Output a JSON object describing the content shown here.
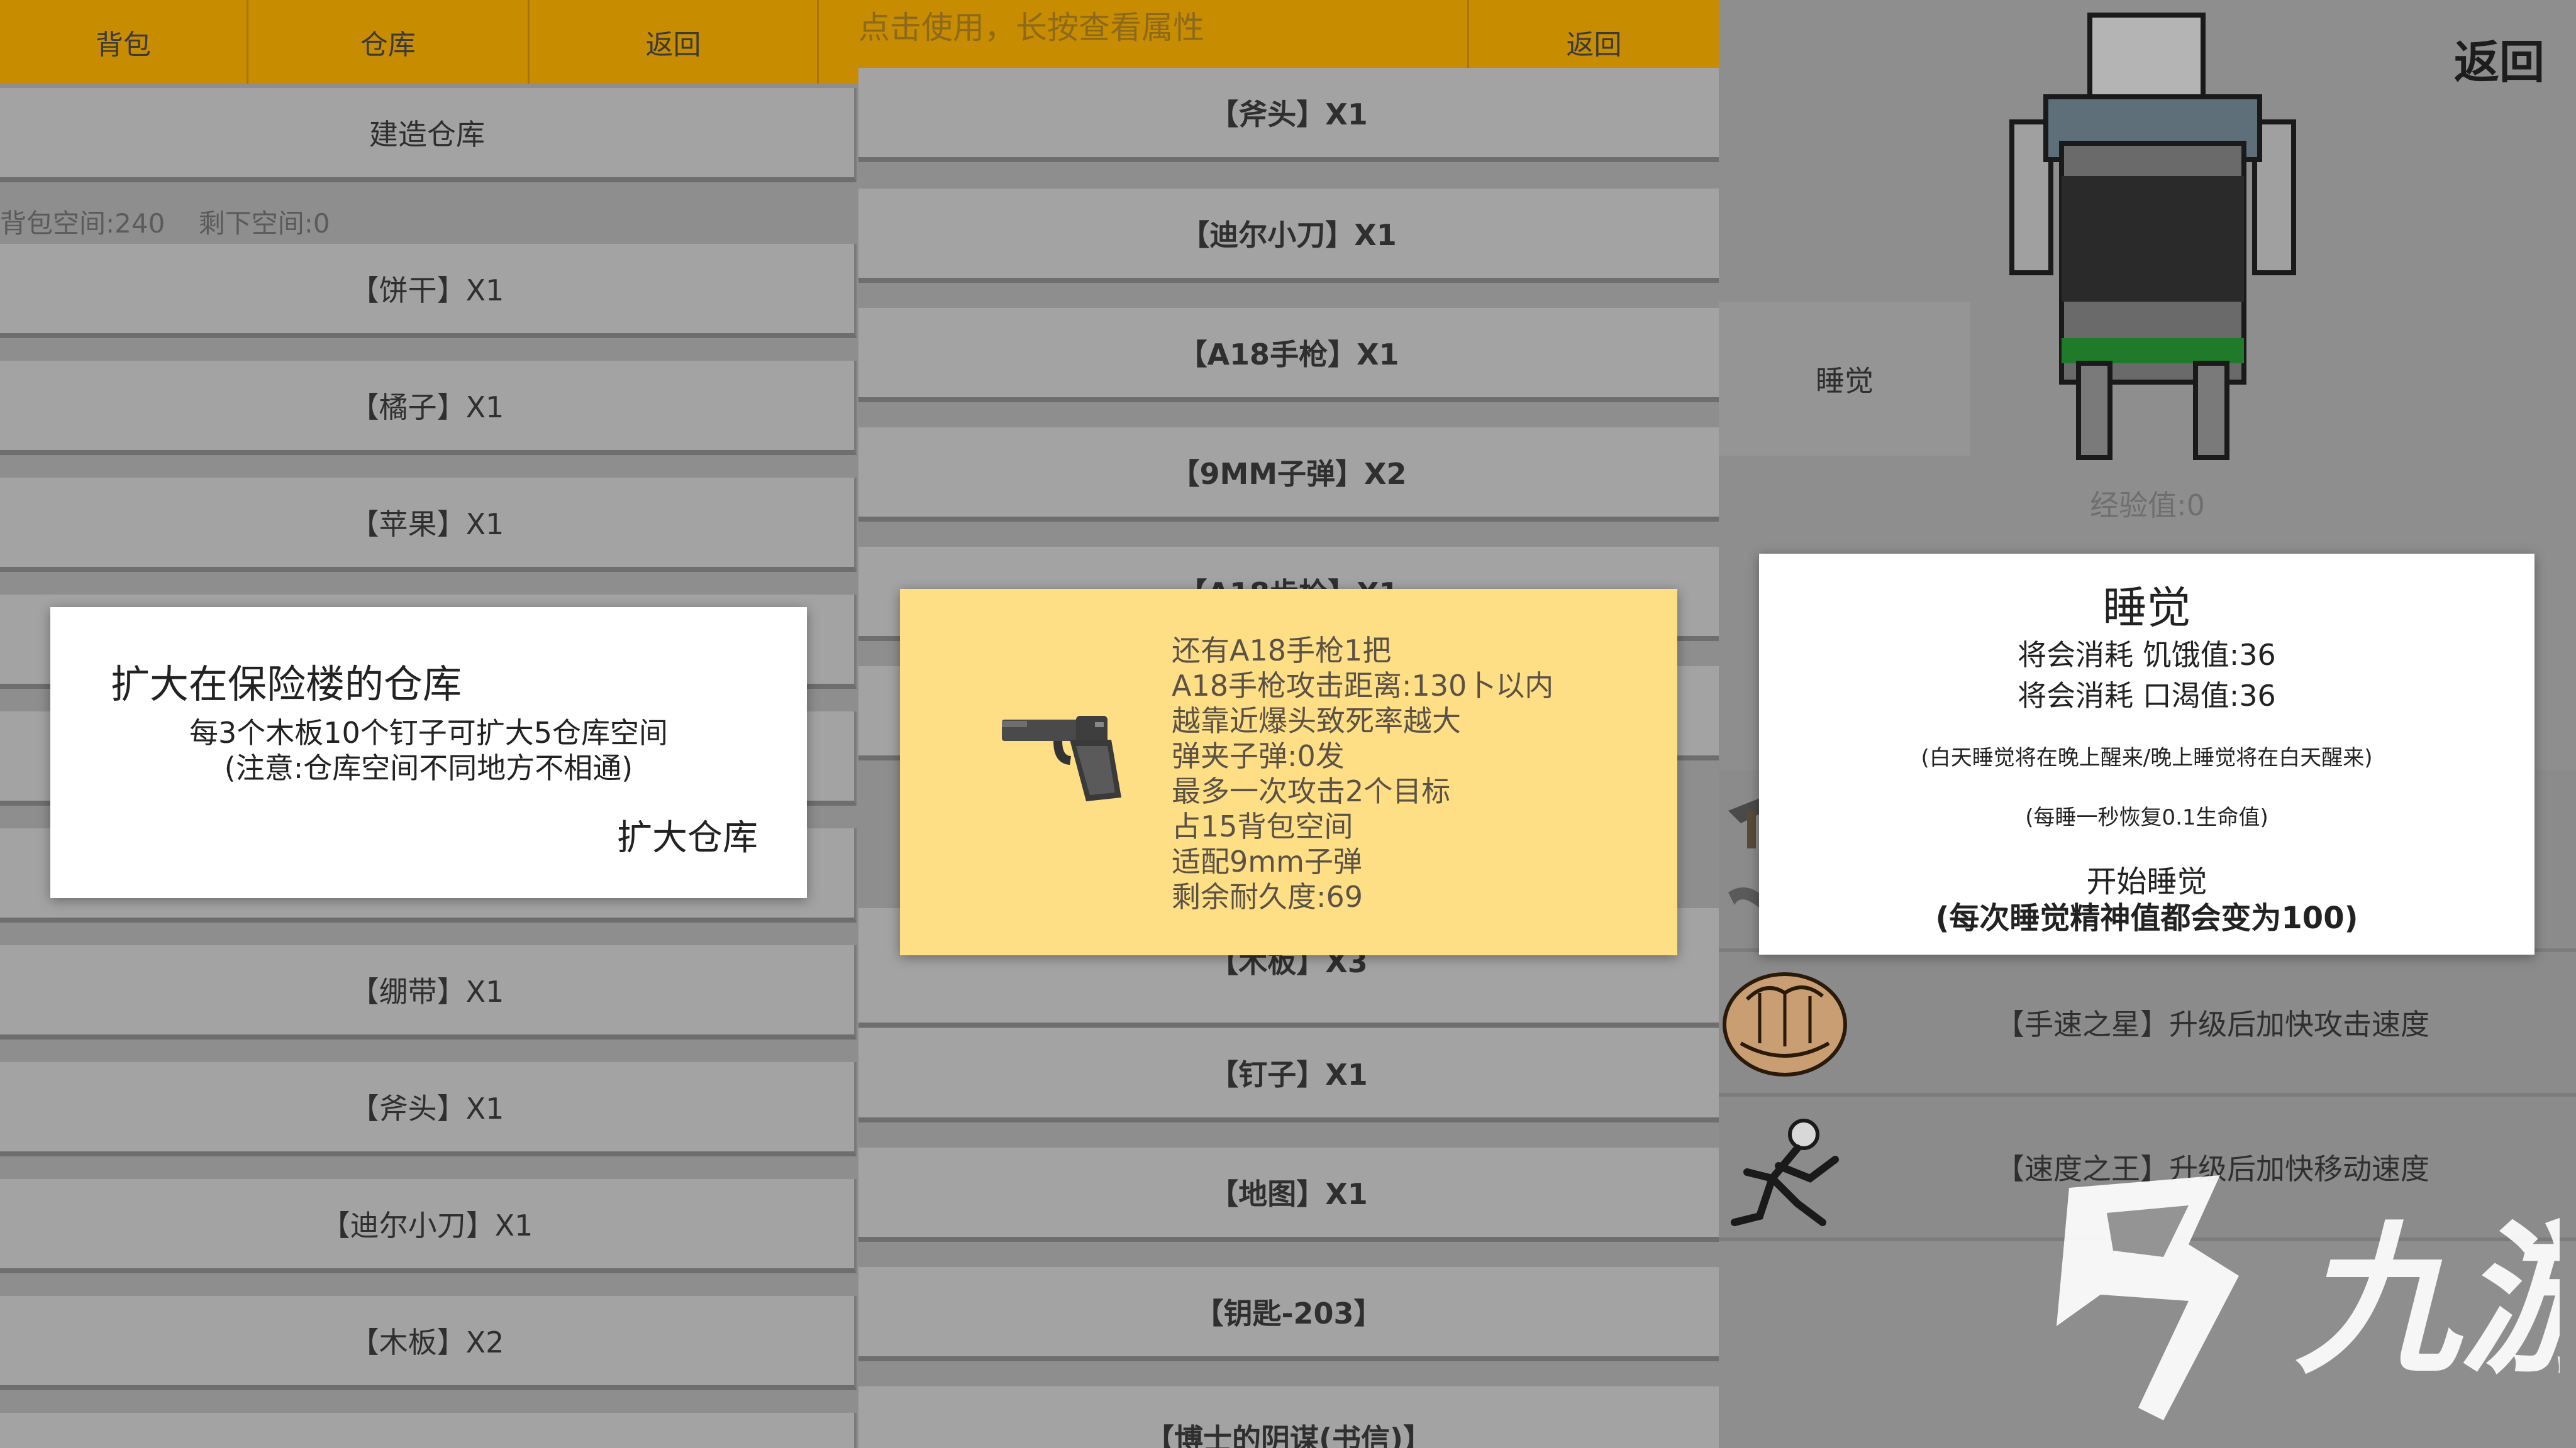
{
  "panel1": {
    "tabs": [
      "背包",
      "仓库",
      "返回"
    ],
    "build_button": "建造仓库",
    "space_info": "背包空间:240    剩下空间:0",
    "items": [
      "【饼干】X1",
      "【橘子】X1",
      "【苹果】X1",
      "【绷带】X1",
      "【斧头】X1",
      "【迪尔小刀】X1",
      "【木板】X2"
    ],
    "dialog": {
      "title": "扩大在保险楼的仓库",
      "line1": "每3个木板10个钉子可扩大5仓库空间",
      "line2": "(注意:仓库空间不同地方不相通)",
      "action": "扩大仓库"
    }
  },
  "panel2": {
    "hint": "点击使用，长按查看属性",
    "back": "返回",
    "items": [
      "【斧头】X1",
      "【迪尔小刀】X1",
      "【A18手枪】X1",
      "【9MM子弹】X2",
      "【钉子】X1",
      "【地图】X1",
      "【钥匙-203】",
      "【博士的阴谋(书信)】"
    ],
    "partial_items": [
      "【A18步枪】X1",
      "【木板】X3"
    ],
    "dialog": {
      "lines": [
        "还有A18手枪1把",
        "A18手枪攻击距离:130卜以内",
        "越靠近爆头致死率越大",
        "弹夹子弹:0发",
        "最多一次攻击2个目标",
        "占15背包空间",
        "适配9mm子弹",
        "剩余耐久度:69"
      ]
    }
  },
  "panel3": {
    "back": "返回",
    "sleep_button": "睡觉",
    "experience": "经验值:0",
    "skills": [
      "【手速之星】升级后加快攻击速度",
      "【速度之王】升级后加快移动速度"
    ],
    "dialog": {
      "title": "睡觉",
      "cost_hunger": "将会消耗 饥饿值:36",
      "cost_thirst": "将会消耗 口渴值:36",
      "note1": "(白天睡觉将在晚上醒来/晚上睡觉将在白天醒来)",
      "note2": "(每睡一秒恢复0.1生命值)",
      "start": "开始睡觉",
      "start_note": "(每次睡觉精神值都会变为100)"
    }
  },
  "watermark": "九游",
  "colors": {
    "topbar": "#c88c00",
    "panel_bg": "#8e8e8e",
    "item_button": "#a3a3a3",
    "tooltip": "#ffdf86",
    "dialog": "#ffffff",
    "character_shirt": "#5f6f7a",
    "character_shorts": "#1f7a2a"
  }
}
